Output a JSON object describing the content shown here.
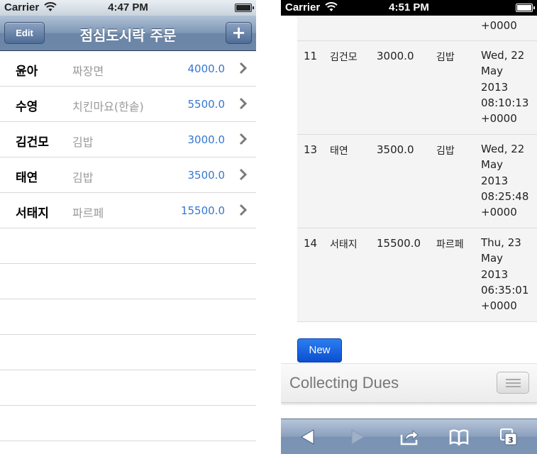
{
  "left": {
    "status": {
      "carrier": "Carrier",
      "time": "4:47 PM"
    },
    "nav": {
      "edit_label": "Edit",
      "title": "점심도시락 주문",
      "add_label": "+"
    },
    "orders": [
      {
        "name": "윤아",
        "menu": "짜장면",
        "price": "4000.0"
      },
      {
        "name": "수영",
        "menu": "치킨마요(한솥)",
        "price": "5500.0"
      },
      {
        "name": "김건모",
        "menu": "김밥",
        "price": "3000.0"
      },
      {
        "name": "태연",
        "menu": "김밥",
        "price": "3500.0"
      },
      {
        "name": "서태지",
        "menu": "파르페",
        "price": "15500.0"
      }
    ]
  },
  "right": {
    "status": {
      "carrier": "Carrier",
      "time": "4:51 PM"
    },
    "prev_row_tail": "+0000",
    "rows": [
      {
        "id": "11",
        "name": "김건모",
        "price": "3000.0",
        "menu": "김밥",
        "date_lines": [
          "Wed, 22",
          "May",
          "2013",
          "08:10:13",
          "+0000"
        ]
      },
      {
        "id": "13",
        "name": "태연",
        "price": "3500.0",
        "menu": "김밥",
        "date_lines": [
          "Wed, 22",
          "May",
          "2013",
          "08:25:48",
          "+0000"
        ]
      },
      {
        "id": "14",
        "name": "서태지",
        "price": "15500.0",
        "menu": "파르페",
        "date_lines": [
          "Thu, 23",
          "May",
          "2013",
          "06:35:01",
          "+0000"
        ]
      }
    ],
    "new_button": "New",
    "footer_title": "Collecting Dues",
    "tabs_count": "3"
  },
  "colors": {
    "nav_bar": "#7e97b5",
    "price_blue": "#3477d3",
    "new_button": "#0a4fd1"
  },
  "icons": [
    "wifi-icon",
    "battery-icon",
    "chevron-right-icon",
    "menu-icon",
    "back-icon",
    "forward-icon",
    "share-icon",
    "bookmarks-icon",
    "tabs-icon"
  ]
}
